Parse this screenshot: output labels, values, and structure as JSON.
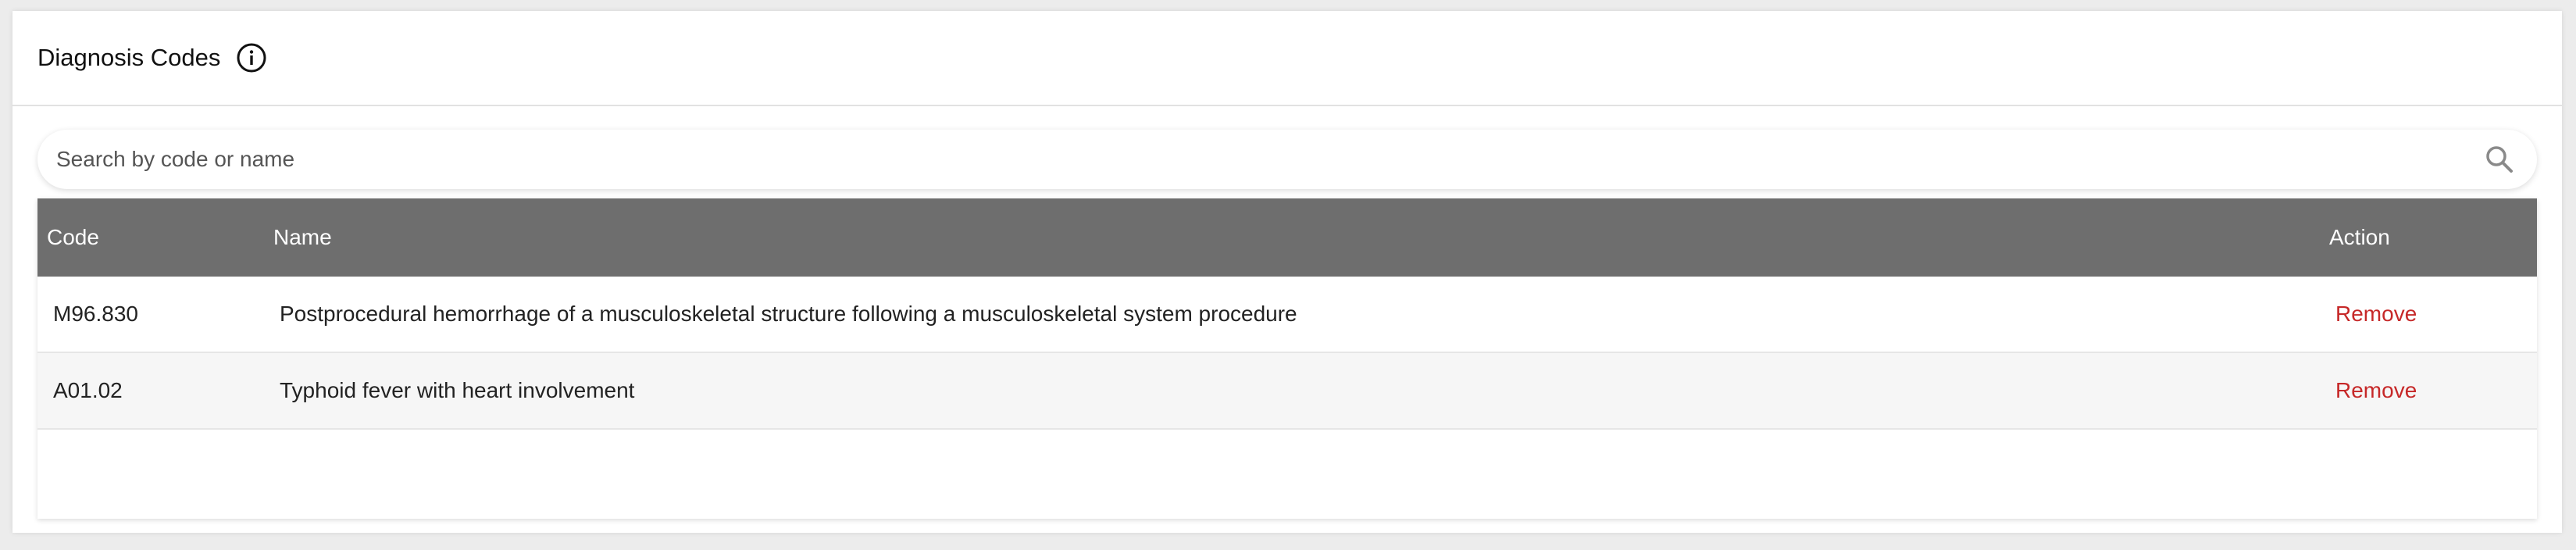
{
  "panel": {
    "title": "Diagnosis Codes",
    "info_icon": "info-circle-icon"
  },
  "search": {
    "placeholder": "Search by code or name",
    "value": "",
    "icon": "search-icon"
  },
  "table": {
    "headers": {
      "code": "Code",
      "name": "Name",
      "action": "Action"
    },
    "rows": [
      {
        "code": "M96.830",
        "name": "Postprocedural hemorrhage of a musculoskeletal structure following a musculoskeletal system procedure",
        "action": "Remove"
      },
      {
        "code": "A01.02",
        "name": "Typhoid fever with heart involvement",
        "action": "Remove"
      }
    ]
  },
  "colors": {
    "header_bg": "#6e6e6e",
    "remove_link": "#c62828",
    "alt_row": "#f6f6f6"
  }
}
